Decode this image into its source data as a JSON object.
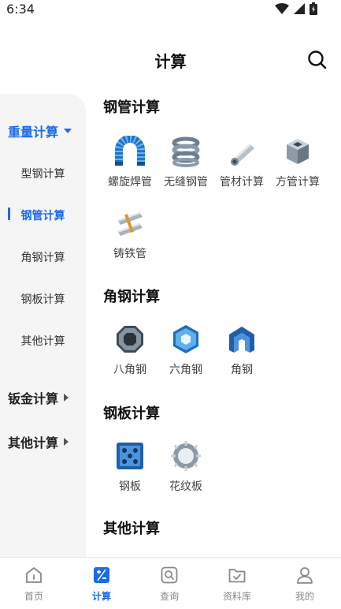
{
  "status_bar": {
    "time": "6:34"
  },
  "header": {
    "title": "计算"
  },
  "sidebar": {
    "groups": [
      {
        "label": "重量计算",
        "expanded": true
      },
      {
        "label": "钣金计算",
        "expanded": false
      },
      {
        "label": "其他计算",
        "expanded": false
      }
    ],
    "items": [
      "型钢计算",
      "钢管计算",
      "角钢计算",
      "钢板计算",
      "其他计算"
    ],
    "active_item": "钢管计算"
  },
  "sections": [
    {
      "title": "钢管计算",
      "items": [
        "螺旋焊管",
        "无缝钢管",
        "管材计算",
        "方管计算",
        "铸铁管"
      ]
    },
    {
      "title": "角钢计算",
      "items": [
        "八角钢",
        "六角钢",
        "角钢"
      ]
    },
    {
      "title": "钢板计算",
      "items": [
        "钢板",
        "花纹板"
      ]
    },
    {
      "title": "其他计算",
      "items": []
    }
  ],
  "tabbar": {
    "tabs": [
      "首页",
      "计算",
      "查询",
      "资料库",
      "我的"
    ],
    "active": "计算"
  },
  "colors": {
    "accent": "#1a6be8",
    "sidebar_bg": "#f5f5f5",
    "text": "#222222"
  }
}
